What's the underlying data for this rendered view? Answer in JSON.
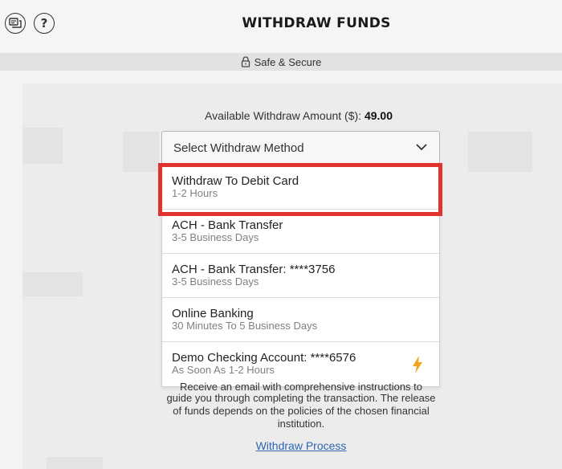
{
  "header": {
    "title": "WITHDRAW FUNDS",
    "help_label": "?",
    "chat_icon": "chat-icon",
    "help_icon": "question-icon"
  },
  "secure": {
    "text": "Safe & Secure",
    "icon": "lock-icon"
  },
  "available": {
    "label": "Available Withdraw Amount ($):",
    "amount": "49.00"
  },
  "select": {
    "placeholder": "Select Withdraw Method",
    "icon": "chevron-down-icon"
  },
  "methods": [
    {
      "label": "Withdraw To Debit Card",
      "sub": "1-2 Hours"
    },
    {
      "label": "ACH - Bank Transfer",
      "sub": "3-5 Business Days"
    },
    {
      "label": "ACH - Bank Transfer: ****3756",
      "sub": "3-5 Business Days"
    },
    {
      "label": "Online Banking",
      "sub": "30 Minutes To 5 Business Days"
    },
    {
      "label": "Demo Checking Account: ****6576",
      "sub": "As Soon As 1-2 Hours",
      "icon": "lightning-icon"
    }
  ],
  "info": {
    "line1": "Receive an email with comprehensive instructions to",
    "line2": "guide you through completing the transaction. The release of funds depends on the policies of the chosen financial institution."
  },
  "link": {
    "label": "Withdraw Process"
  },
  "colors": {
    "highlight": "#e0322e",
    "link": "#2c67b4",
    "bolt": "#f2a31b"
  }
}
